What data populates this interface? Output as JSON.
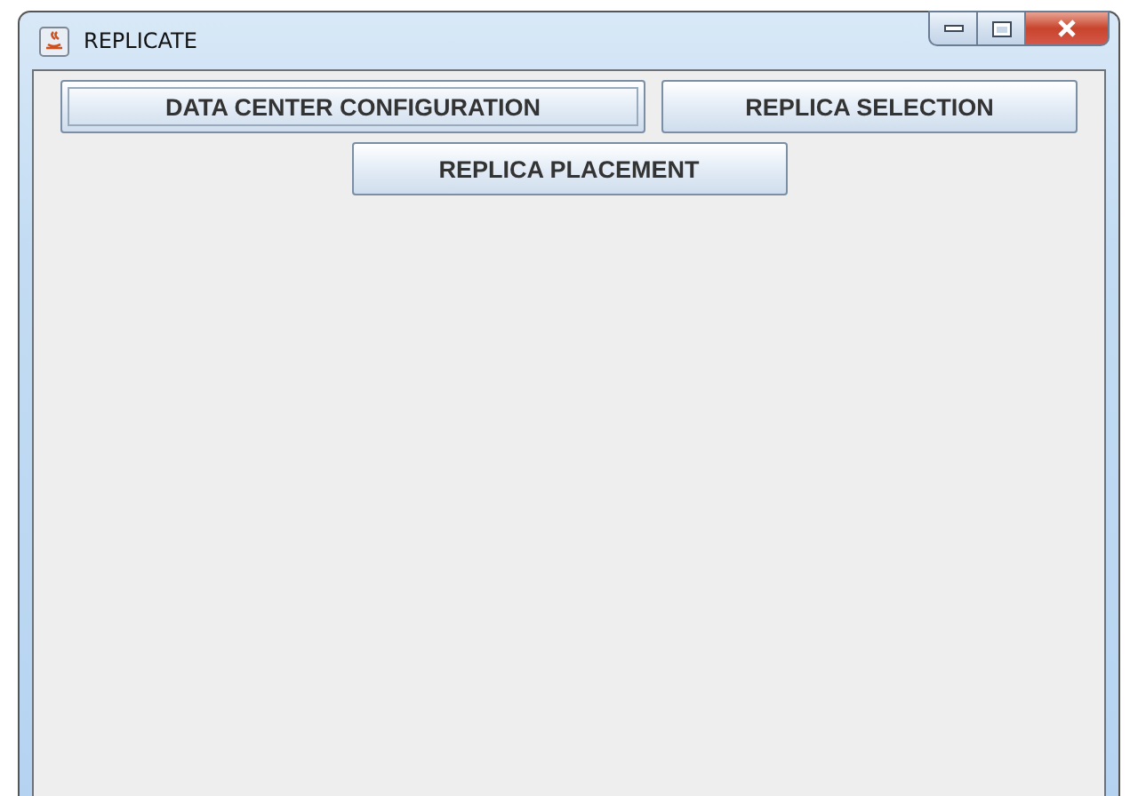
{
  "window": {
    "title": "REPLICATE"
  },
  "buttons": [
    {
      "label": "DATA CENTER CONFIGURATION",
      "focused": true
    },
    {
      "label": "REPLICA SELECTION",
      "focused": false
    },
    {
      "label": "REPLICA PLACEMENT",
      "focused": false
    }
  ]
}
